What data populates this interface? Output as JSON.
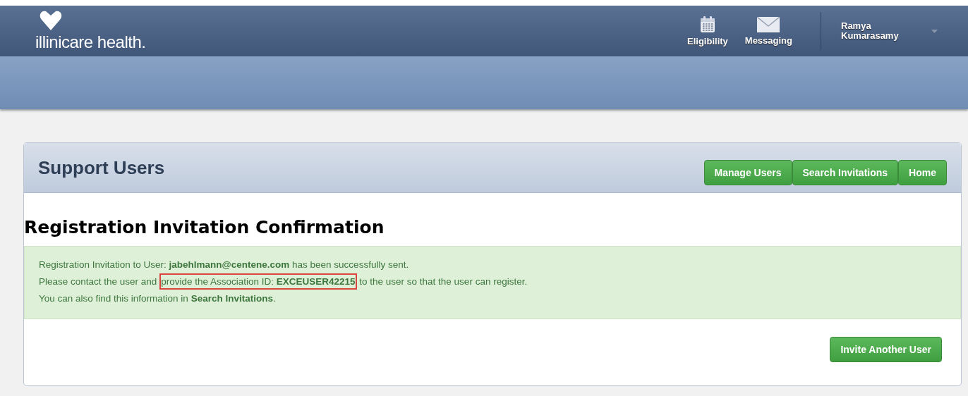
{
  "header": {
    "logo_text": "illinicare health.",
    "nav": [
      {
        "label": "Eligibility",
        "kind": "calendar"
      },
      {
        "label": "Messaging",
        "kind": "mail"
      }
    ],
    "user": {
      "first_name": "Ramya",
      "last_name": "Kumarasamy"
    }
  },
  "panel": {
    "title": "Support Users",
    "buttons": [
      "Manage Users",
      "Search Invitations",
      "Home"
    ]
  },
  "confirmation": {
    "heading": "Registration Invitation Confirmation",
    "lines": [
      [
        {
          "text": "Registration Invitation to User: **jabehlmann@centene.com** has been successfully sent.",
          "highlighted": false
        }
      ],
      [
        {
          "text": "Please contact the user and ",
          "highlighted": false
        },
        {
          "text": "provide the Association ID: **EXCEUSER42215**",
          "highlighted": true
        },
        {
          "text": " to the user so that the user can register.",
          "highlighted": false
        }
      ],
      [
        {
          "text": "You can also find this information in **Search Invitations**.",
          "highlighted": false
        }
      ]
    ],
    "action": "Invite Another User"
  }
}
